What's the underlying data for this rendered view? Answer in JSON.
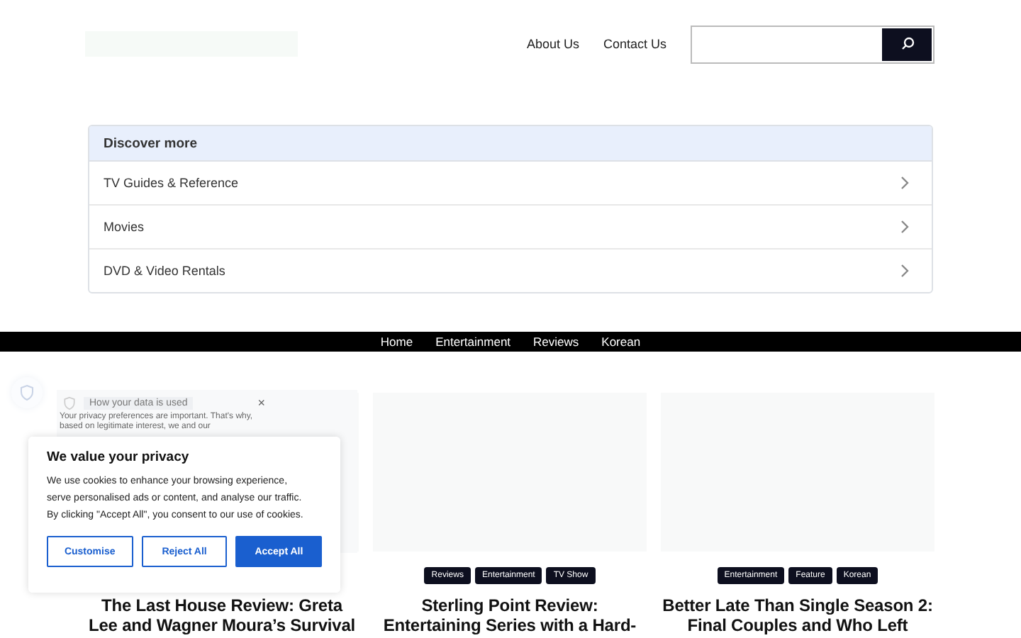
{
  "header": {
    "nav": [
      "About Us",
      "Contact Us"
    ]
  },
  "discover": {
    "title": "Discover more",
    "items": [
      "TV Guides & Reference",
      "Movies",
      "DVD & Video Rentals"
    ]
  },
  "menu": [
    "Home",
    "Entertainment",
    "Reviews",
    "Korean"
  ],
  "articles": [
    {
      "title": "The Last House Review: Greta Lee and Wagner Moura’s Survival"
    },
    {
      "tags": [
        "Reviews",
        "Entertainment",
        "TV Show"
      ],
      "title": "Sterling Point Review: Entertaining Series with a Hard-"
    },
    {
      "tags": [
        "Entertainment",
        "Feature",
        "Korean"
      ],
      "title": "Better Late Than Single Season 2: Final Couples and Who Left"
    }
  ],
  "privacy_panel": {
    "title": "How your data is used",
    "close": "×",
    "text": "Your privacy preferences are important. That's why, based on legitimate interest, we and our"
  },
  "cookie_dialog": {
    "title": "We value your privacy",
    "text": "We use cookies to enhance your browsing experience, serve personalised ads or content, and analyse our traffic. By clicking \"Accept All\", you consent to our use of cookies.",
    "buttons": [
      {
        "label": "Customise",
        "kind": "outline"
      },
      {
        "label": "Reject All",
        "kind": "outline"
      },
      {
        "label": "Accept All",
        "kind": "primary"
      }
    ]
  }
}
